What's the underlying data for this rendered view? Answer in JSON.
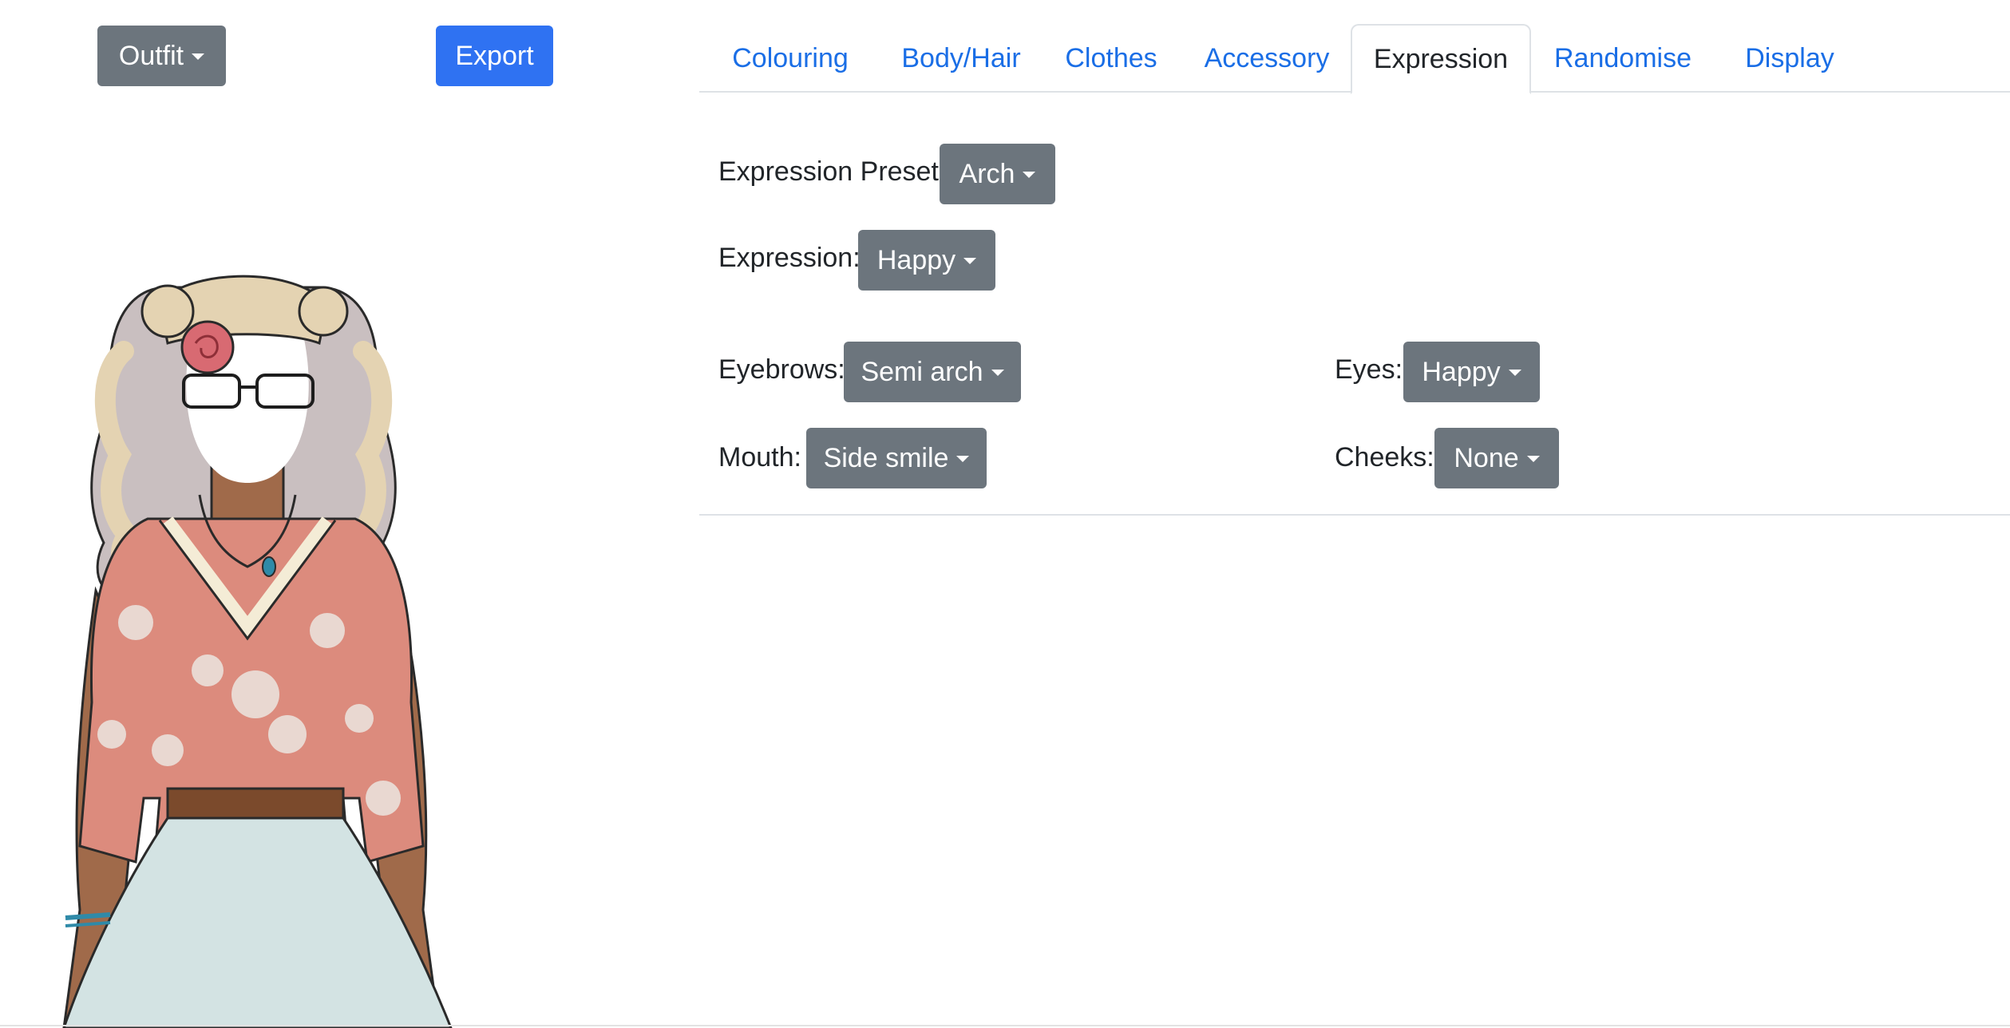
{
  "toolbar": {
    "outfit_label": "Outfit",
    "export_label": "Export"
  },
  "tabs": [
    {
      "label": "Colouring"
    },
    {
      "label": "Body/Hair"
    },
    {
      "label": "Clothes"
    },
    {
      "label": "Accessory"
    },
    {
      "label": "Expression",
      "active": true
    },
    {
      "label": "Randomise"
    },
    {
      "label": "Display"
    }
  ],
  "expression": {
    "preset_label": "Expression Preset:",
    "preset_value": "Arch",
    "expression_label": "Expression:",
    "expression_value": "Happy",
    "eyebrows_label": "Eyebrows:",
    "eyebrows_value": "Semi arch",
    "eyes_label": "Eyes:",
    "eyes_value": "Happy",
    "mouth_label": "Mouth:",
    "mouth_value": "Side smile",
    "cheeks_label": "Cheeks:",
    "cheeks_value": "None"
  },
  "colors": {
    "primary": "#2f72f2",
    "secondary": "#6c757d",
    "link": "#1a6ee6",
    "top": "#dc8b7d",
    "skirt": "#d3e3e3",
    "hair": "#e4d3b2",
    "skin": "#a06a4a"
  }
}
